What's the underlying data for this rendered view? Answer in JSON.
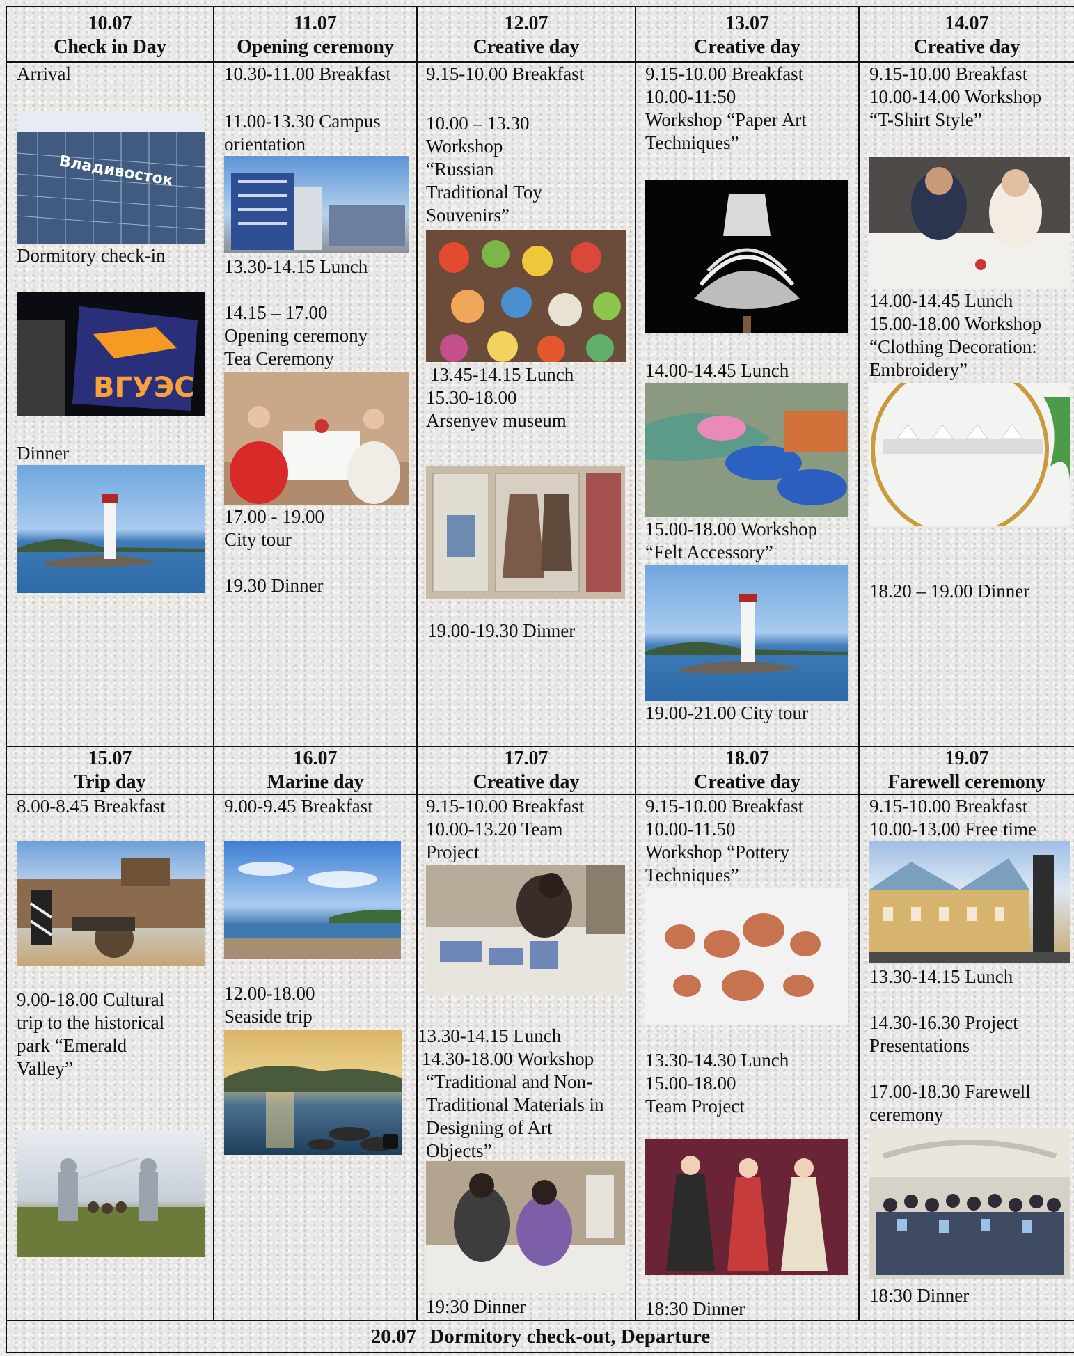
{
  "week1": [
    {
      "date": "10.07",
      "theme": "Check in Day"
    },
    {
      "date": "11.07",
      "theme": "Opening ceremony"
    },
    {
      "date": "12.07",
      "theme": "Creative day"
    },
    {
      "date": "13.07",
      "theme": "Creative day"
    },
    {
      "date": "14.07",
      "theme": "Creative day"
    }
  ],
  "week2": [
    {
      "date": "15.07",
      "theme": "Trip day"
    },
    {
      "date": "16.07",
      "theme": "Marine day"
    },
    {
      "date": "17.07",
      "theme": "Creative day"
    },
    {
      "date": "18.07",
      "theme": "Creative day"
    },
    {
      "date": "19.07",
      "theme": "Farewell ceremony"
    }
  ],
  "d1007": {
    "arrival": "Arrival",
    "checkin": "Dormitory check-in",
    "dinner": "Dinner",
    "sign1": "Владивосток",
    "sign2": "ВГУЭС"
  },
  "d1107": {
    "l1": "10.30-11.00 Breakfast",
    "l2": "11.00-13.30 Campus",
    "l3": "orientation",
    "l4": "13.30-14.15  Lunch",
    "l5": "14.15 – 17.00",
    "l6": "Opening ceremony",
    "l7": "Tea Ceremony",
    "l8": "17.00 - 19.00",
    "l9": "City tour",
    "l10": "19.30 Dinner"
  },
  "d1207": {
    "l1": "9.15-10.00 Breakfast",
    "l2": "10.00 – 13.30",
    "l3": "Workshop",
    "l4": "“Russian",
    "l5": "Traditional Toy",
    "l6": "Souvenirs”",
    "l7": "13.45-14.15 Lunch",
    "l8": "15.30-18.00",
    "l9": "Arsenyev museum",
    "l10": "19.00-19.30 Dinner"
  },
  "d1307": {
    "l1": "9.15-10.00 Breakfast",
    "l2": "10.00-11:50",
    "l3": "Workshop “Paper Art",
    "l4": "Techniques”",
    "l5": "14.00-14.45 Lunch",
    "l6": "15.00-18.00 Workshop",
    "l7": "“Felt Accessory”",
    "l8": "19.00-21.00 City tour"
  },
  "d1407": {
    "l1": "9.15-10.00 Breakfast",
    "l2": "10.00-14.00 Workshop",
    "l3": "“T-Shirt Style”",
    "l4": "14.00-14.45 Lunch",
    "l5": "15.00-18.00 Workshop",
    "l6": "“Clothing Decoration:",
    "l7": "Embroidery”",
    "l8": "18.20 – 19.00 Dinner"
  },
  "d1507": {
    "l1": "8.00-8.45 Breakfast",
    "l2": "9.00-18.00 Cultural",
    "l3": "trip to the historical",
    "l4": "park  “Emerald",
    "l5": "Valley”"
  },
  "d1607": {
    "l1": "9.00-9.45 Breakfast",
    "l2": "12.00-18.00",
    "l3": "Seaside trip"
  },
  "d1707": {
    "l1": "9.15-10.00 Breakfast",
    "l2": "10.00-13.20 Team",
    "l3": "Project",
    "l4": "13.30-14.15 Lunch",
    "l5": "14.30-18.00 Workshop",
    "l6": "“Traditional and Non-",
    "l7": "Traditional Materials in",
    "l8": "Designing of Art",
    "l9": "Objects”",
    "l10": "19:30 Dinner"
  },
  "d1807": {
    "l1": "9.15-10.00 Breakfast",
    "l2": "10.00-11.50",
    "l3": "Workshop “Pottery",
    "l4": "Techniques”",
    "l5": "13.30-14.30  Lunch",
    "l6": "15.00-18.00",
    "l7": "Team Project",
    "l8": "18:30 Dinner"
  },
  "d1907": {
    "l1": "9.15-10.00 Breakfast",
    "l2": "10.00-13.00 Free time",
    "l3": "13.30-14.15 Lunch",
    "l4": "14.30-16.30 Project",
    "l5": "Presentations",
    "l6": "17.00-18.30 Farewell",
    "l7": "ceremony",
    "l8": "18:30 Dinner"
  },
  "footer": {
    "date": "20.07",
    "text": "Dormitory check-out, Departure"
  },
  "colors": {
    "grid": "#111111",
    "background": "#e9e7e4"
  }
}
